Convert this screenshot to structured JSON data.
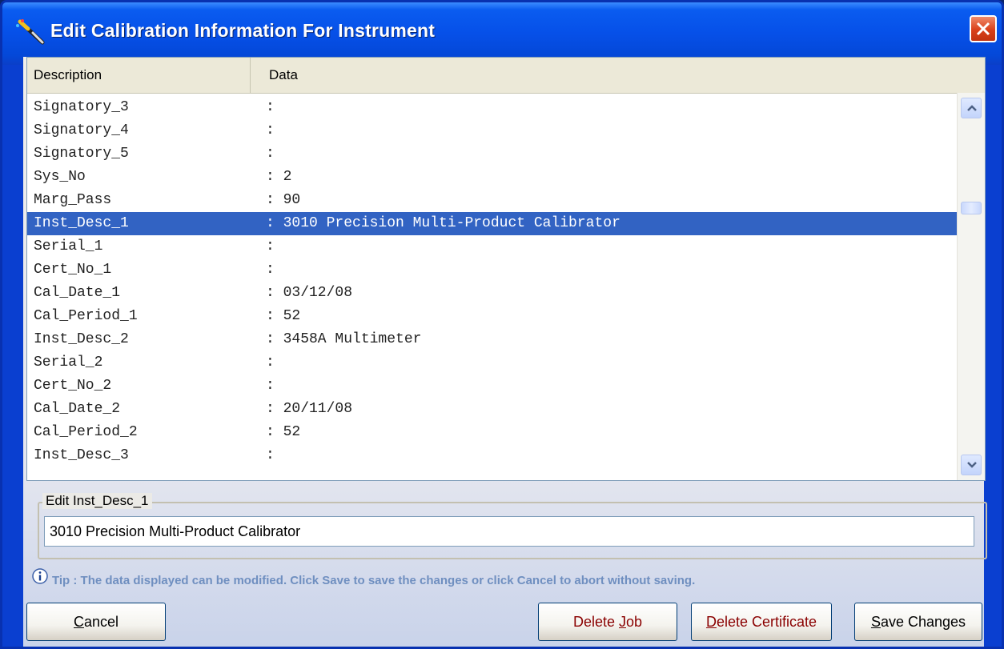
{
  "window": {
    "title": "Edit Calibration Information For Instrument"
  },
  "list": {
    "columns": [
      "Description",
      "Data"
    ],
    "rows": [
      {
        "desc": "Signatory_3",
        "data": ":"
      },
      {
        "desc": "Signatory_4",
        "data": ":"
      },
      {
        "desc": "Signatory_5",
        "data": ":"
      },
      {
        "desc": "Sys_No",
        "data": ": 2"
      },
      {
        "desc": "Marg_Pass",
        "data": ": 90"
      },
      {
        "desc": "Inst_Desc_1",
        "data": ": 3010 Precision Multi-Product Calibrator",
        "selected": true
      },
      {
        "desc": "Serial_1",
        "data": ":"
      },
      {
        "desc": "Cert_No_1",
        "data": ":"
      },
      {
        "desc": "Cal_Date_1",
        "data": ": 03/12/08"
      },
      {
        "desc": "Cal_Period_1",
        "data": ": 52"
      },
      {
        "desc": "Inst_Desc_2",
        "data": ": 3458A Multimeter"
      },
      {
        "desc": "Serial_2",
        "data": ":"
      },
      {
        "desc": "Cert_No_2",
        "data": ":"
      },
      {
        "desc": "Cal_Date_2",
        "data": ": 20/11/08"
      },
      {
        "desc": "Cal_Period_2",
        "data": ": 52"
      },
      {
        "desc": "Inst_Desc_3",
        "data": ":"
      }
    ]
  },
  "edit": {
    "legend": "Edit Inst_Desc_1",
    "value": "3010 Precision Multi-Product Calibrator"
  },
  "tip": "Tip : The data displayed can be modified. Click Save to save the changes or click Cancel to abort without saving.",
  "buttons": {
    "cancel": {
      "pre": "",
      "key": "C",
      "post": "ancel"
    },
    "delete_job": {
      "pre": "Delete ",
      "key": "J",
      "post": "ob"
    },
    "delete_certificate": {
      "pre": "",
      "key": "D",
      "post": "elete Certificate"
    },
    "save_changes": {
      "pre": "",
      "key": "S",
      "post": "ave Changes"
    }
  },
  "colors": {
    "selection": "#3263c3",
    "titlebar": "#0650e8",
    "tip_text": "#6f8fc0",
    "delete_text": "#8a0000"
  },
  "icons": {
    "title": "calibration-tool-icon",
    "close": "close-icon",
    "tip": "info-icon",
    "scroll_up": "chevron-up-icon",
    "scroll_down": "chevron-down-icon"
  }
}
